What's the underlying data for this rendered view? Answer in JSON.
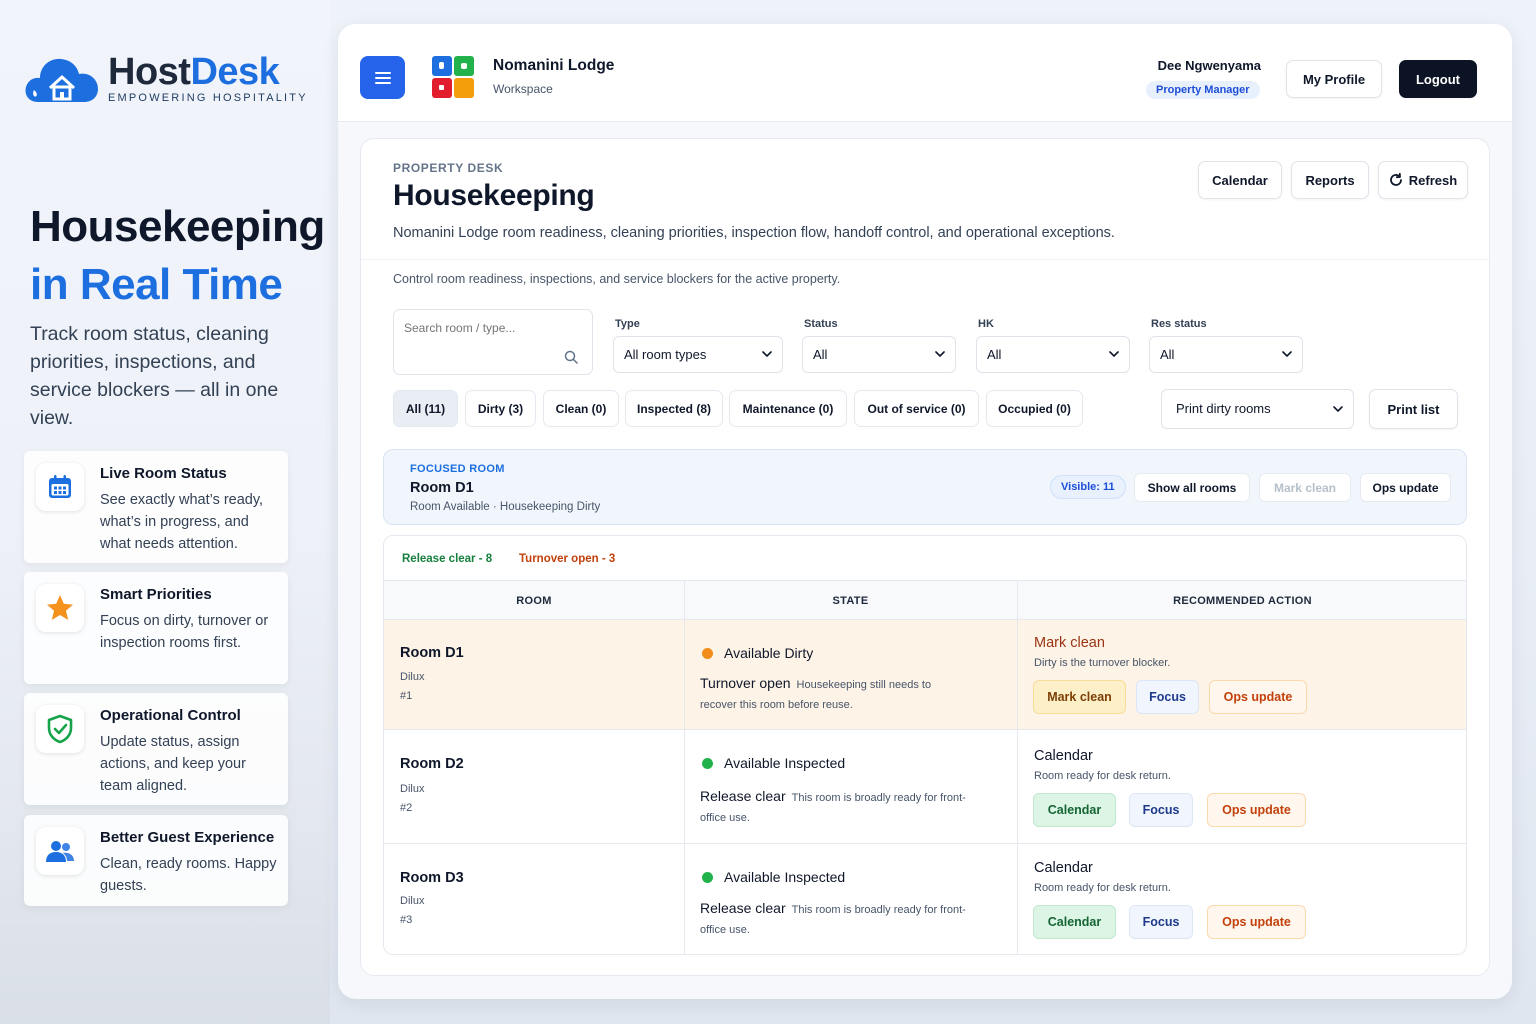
{
  "brand": {
    "name_part1": "Host",
    "name_part2": "Desk",
    "tagline": "EMPOWERING HOSPITALITY",
    "colors": {
      "primary": "#1d6fe0",
      "dark": "#1e293b"
    }
  },
  "hero": {
    "title_line1": "Housekeeping",
    "title_line2": "in Real Time",
    "subtitle": "Track room status, cleaning priorities, inspections, and service blockers — all in one view."
  },
  "features": [
    {
      "icon": "calendar-icon",
      "title": "Live Room Status",
      "desc": "See exactly what’s ready, what’s in progress, and what needs attention."
    },
    {
      "icon": "star-icon",
      "title": "Smart Priorities",
      "desc": "Focus on dirty, turnover or inspection rooms first."
    },
    {
      "icon": "shield-check-icon",
      "title": "Operational Control",
      "desc": "Update status, assign actions, and keep your team aligned."
    },
    {
      "icon": "users-icon",
      "title": "Better Guest Experience",
      "desc": "Clean, ready rooms. Happy guests."
    }
  ],
  "topbar": {
    "menu_icon": "hamburger-icon",
    "workspace_name": "Nomanini Lodge",
    "workspace_label": "Workspace",
    "user_name": "Dee Ngwenyama",
    "user_role": "Property Manager",
    "profile_label": "My Profile",
    "logout_label": "Logout"
  },
  "page": {
    "kicker": "PROPERTY DESK",
    "title": "Housekeeping",
    "description": "Nomanini Lodge room readiness, cleaning priorities, inspection flow, handoff control, and operational exceptions.",
    "actions": {
      "calendar": "Calendar",
      "reports": "Reports",
      "refresh": "Refresh"
    },
    "control_note": "Control room readiness, inspections, and service blockers for the active property."
  },
  "filters": {
    "search_placeholder": "Search room / type...",
    "type": {
      "label": "Type",
      "value": "All room types"
    },
    "status": {
      "label": "Status",
      "value": "All"
    },
    "hk": {
      "label": "HK",
      "value": "All"
    },
    "res_status": {
      "label": "Res status",
      "value": "All"
    }
  },
  "chips": [
    {
      "label": "All (11)",
      "active": true
    },
    {
      "label": "Dirty (3)"
    },
    {
      "label": "Clean (0)"
    },
    {
      "label": "Inspected (8)"
    },
    {
      "label": "Maintenance (0)"
    },
    {
      "label": "Out of service (0)"
    },
    {
      "label": "Occupied (0)"
    }
  ],
  "print": {
    "select_value": "Print dirty rooms",
    "button": "Print list"
  },
  "focused": {
    "kicker": "FOCUSED ROOM",
    "title": "Room D1",
    "subtitle": "Room Available · Housekeeping Dirty",
    "visible_badge": "Visible: 11",
    "show_all": "Show all rooms",
    "mark_clean": "Mark clean",
    "ops_update": "Ops update"
  },
  "summary": {
    "release": "Release clear - 8",
    "turnover": "Turnover open - 3"
  },
  "table": {
    "headers": {
      "room": "ROOM",
      "state": "STATE",
      "action": "RECOMMENDED ACTION"
    },
    "rows": [
      {
        "name": "Room D1",
        "type": "Dilux",
        "num": "#1",
        "state": "Available Dirty",
        "dot_color": "#f28c1b",
        "note_title": "Turnover open",
        "note": "Housekeeping still needs to recover this room before reuse.",
        "action_title": "Mark clean",
        "action_sub": "Dirty is the turnover blocker.",
        "btn1": "Mark clean",
        "btn2": "Focus",
        "btn3": "Ops update"
      },
      {
        "name": "Room D2",
        "type": "Dilux",
        "num": "#2",
        "state": "Available Inspected",
        "dot_color": "#22b24c",
        "note_title": "Release clear",
        "note": "This room is broadly ready for front-office use.",
        "action_title": "Calendar",
        "action_sub": "Room ready for desk return.",
        "btn1": "Calendar",
        "btn2": "Focus",
        "btn3": "Ops update"
      },
      {
        "name": "Room D3",
        "type": "Dilux",
        "num": "#3",
        "state": "Available Inspected",
        "dot_color": "#22b24c",
        "note_title": "Release clear",
        "note": "This room is broadly ready for front-office use.",
        "action_title": "Calendar",
        "action_sub": "Room ready for desk return.",
        "btn1": "Calendar",
        "btn2": "Focus",
        "btn3": "Ops update"
      }
    ]
  }
}
